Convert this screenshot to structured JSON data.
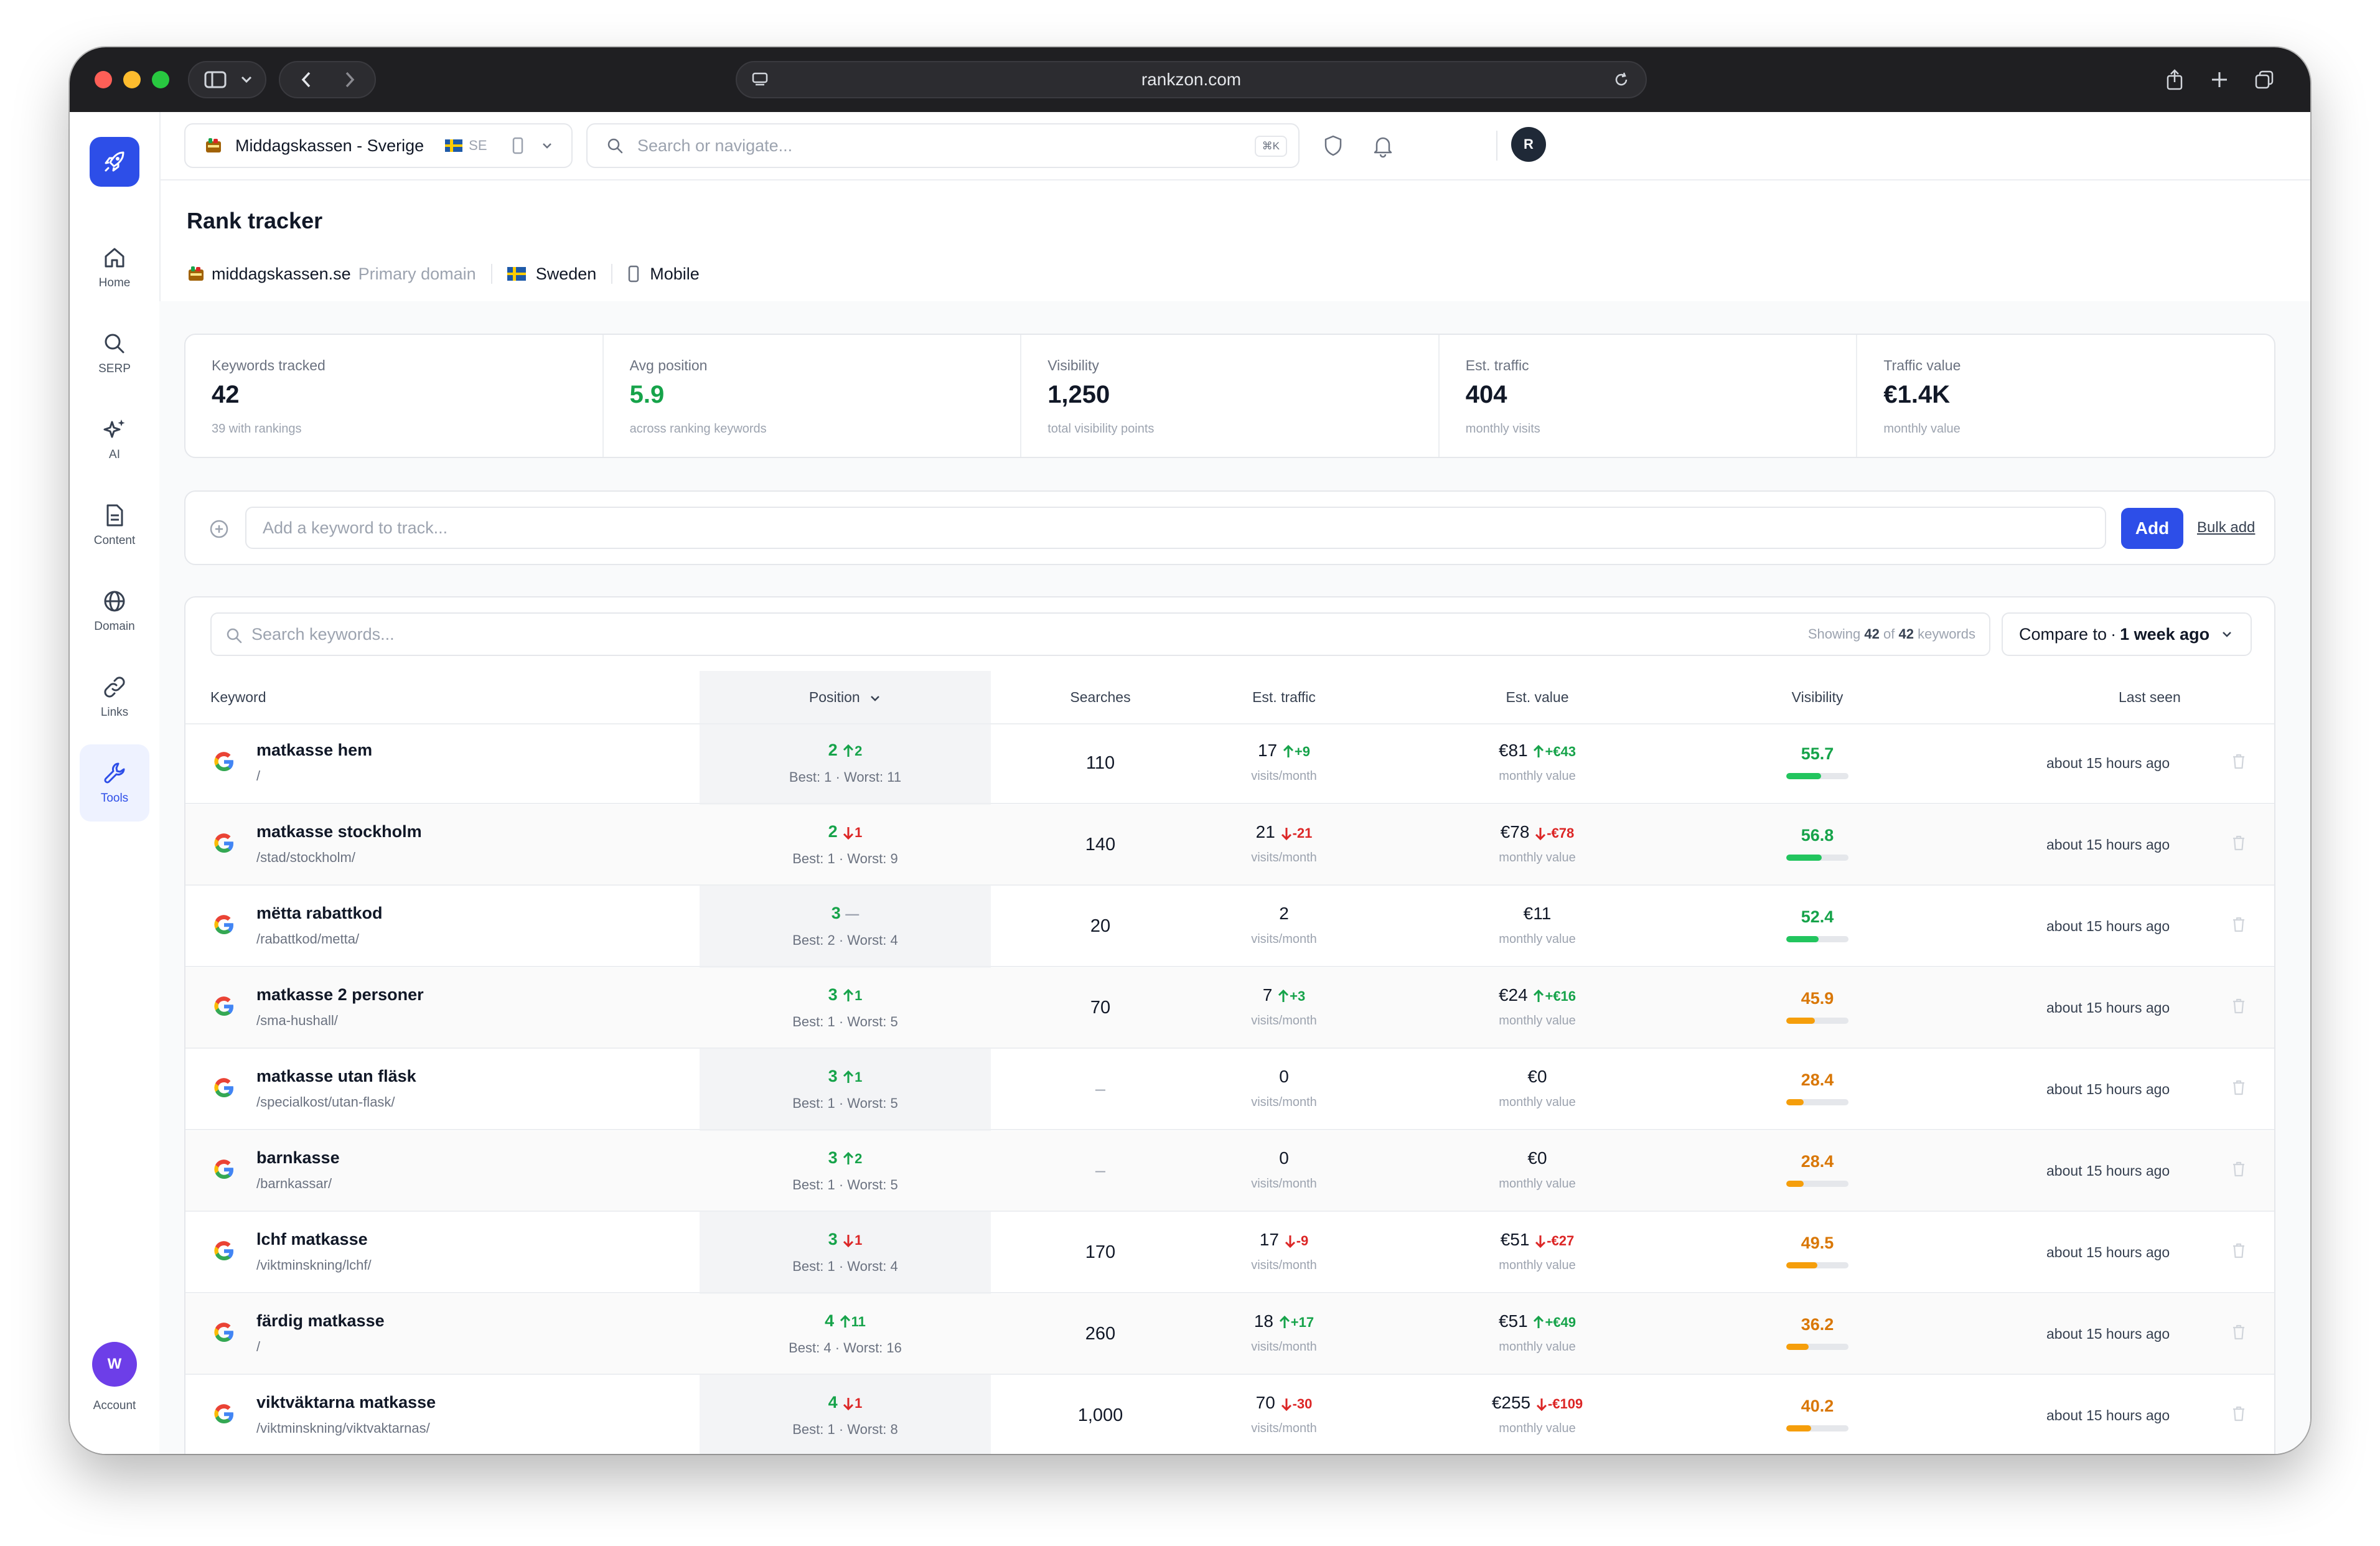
{
  "browser": {
    "url": "rankzon.com"
  },
  "sidebar": {
    "items": [
      {
        "label": "Home",
        "icon": "home-icon"
      },
      {
        "label": "SERP",
        "icon": "search-icon"
      },
      {
        "label": "AI",
        "icon": "sparkles-icon"
      },
      {
        "label": "Content",
        "icon": "document-icon"
      },
      {
        "label": "Domain",
        "icon": "globe-icon"
      },
      {
        "label": "Links",
        "icon": "link-icon"
      },
      {
        "label": "Tools",
        "icon": "wrench-icon",
        "active": true
      }
    ],
    "account": {
      "initial": "W",
      "label": "Account"
    }
  },
  "topbar": {
    "project": "Middagskassen - Sverige",
    "country_code": "SE",
    "search_placeholder": "Search or navigate...",
    "shortcut": "⌘K",
    "user_initial": "R"
  },
  "page": {
    "title": "Rank tracker",
    "domain": "middagskassen.se",
    "domain_tag": "Primary domain",
    "country": "Sweden",
    "device": "Mobile"
  },
  "stats": [
    {
      "label": "Keywords tracked",
      "value": "42",
      "sub": "39 with rankings"
    },
    {
      "label": "Avg position",
      "value": "5.9",
      "sub": "across ranking keywords",
      "accent": "#16a34a"
    },
    {
      "label": "Visibility",
      "value": "1,250",
      "sub": "total visibility points"
    },
    {
      "label": "Est. traffic",
      "value": "404",
      "sub": "monthly visits"
    },
    {
      "label": "Traffic value",
      "value": "€1.4K",
      "sub": "monthly value"
    }
  ],
  "add_keyword": {
    "placeholder": "Add a keyword to track...",
    "button": "Add",
    "bulk_link": "Bulk add"
  },
  "table_controls": {
    "search_placeholder": "Search keywords...",
    "showing_prefix": "Showing",
    "showing_count": "42",
    "showing_of": "of",
    "showing_total": "42",
    "showing_suffix": "keywords",
    "compare_label": "Compare to",
    "compare_value": "1 week ago"
  },
  "columns": {
    "keyword": "Keyword",
    "position": "Position",
    "searches": "Searches",
    "traffic": "Est. traffic",
    "value": "Est. value",
    "visibility": "Visibility",
    "last_seen": "Last seen"
  },
  "units": {
    "traffic": "visits/month",
    "value": "monthly value"
  },
  "colors": {
    "accent": "#2d4ee8",
    "up": "#16a34a",
    "down": "#dc2626",
    "vis_high": "#22c55e",
    "vis_mid": "#f59e0b"
  },
  "rows": [
    {
      "keyword": "matkasse hem",
      "url": "/",
      "position": "2",
      "pos_dir": "up",
      "pos_delta": "2",
      "best_worst": "Best: 1 · Worst: 11",
      "searches": "110",
      "traffic": "17",
      "traffic_dir": "up",
      "traffic_delta": "+9",
      "value": "€81",
      "value_dir": "up",
      "value_delta": "+€43",
      "visibility": "55.7",
      "vis_level": 0.557,
      "last_seen": "about 15 hours ago"
    },
    {
      "keyword": "matkasse stockholm",
      "url": "/stad/stockholm/",
      "position": "2",
      "pos_dir": "down",
      "pos_delta": "1",
      "best_worst": "Best: 1 · Worst: 9",
      "searches": "140",
      "traffic": "21",
      "traffic_dir": "down",
      "traffic_delta": "-21",
      "value": "€78",
      "value_dir": "down",
      "value_delta": "-€78",
      "visibility": "56.8",
      "vis_level": 0.568,
      "last_seen": "about 15 hours ago"
    },
    {
      "keyword": "mëtta rabattkod",
      "url": "/rabattkod/metta/",
      "position": "3",
      "pos_dir": "none",
      "pos_delta": "—",
      "best_worst": "Best: 2 · Worst: 4",
      "searches": "20",
      "traffic": "2",
      "traffic_dir": "none",
      "traffic_delta": "",
      "value": "€11",
      "value_dir": "none",
      "value_delta": "",
      "visibility": "52.4",
      "vis_level": 0.524,
      "last_seen": "about 15 hours ago"
    },
    {
      "keyword": "matkasse 2 personer",
      "url": "/sma-hushall/",
      "position": "3",
      "pos_dir": "up",
      "pos_delta": "1",
      "best_worst": "Best: 1 · Worst: 5",
      "searches": "70",
      "traffic": "7",
      "traffic_dir": "up",
      "traffic_delta": "+3",
      "value": "€24",
      "value_dir": "up",
      "value_delta": "+€16",
      "visibility": "45.9",
      "vis_level": 0.459,
      "last_seen": "about 15 hours ago"
    },
    {
      "keyword": "matkasse utan fläsk",
      "url": "/specialkost/utan-flask/",
      "position": "3",
      "pos_dir": "up",
      "pos_delta": "1",
      "best_worst": "Best: 1 · Worst: 5",
      "searches": "–",
      "traffic": "0",
      "traffic_dir": "none",
      "traffic_delta": "",
      "value": "€0",
      "value_dir": "none",
      "value_delta": "",
      "visibility": "28.4",
      "vis_level": 0.284,
      "last_seen": "about 15 hours ago"
    },
    {
      "keyword": "barnkasse",
      "url": "/barnkassar/",
      "position": "3",
      "pos_dir": "up",
      "pos_delta": "2",
      "best_worst": "Best: 1 · Worst: 5",
      "searches": "–",
      "traffic": "0",
      "traffic_dir": "none",
      "traffic_delta": "",
      "value": "€0",
      "value_dir": "none",
      "value_delta": "",
      "visibility": "28.4",
      "vis_level": 0.284,
      "last_seen": "about 15 hours ago"
    },
    {
      "keyword": "lchf matkasse",
      "url": "/viktminskning/lchf/",
      "position": "3",
      "pos_dir": "down",
      "pos_delta": "1",
      "best_worst": "Best: 1 · Worst: 4",
      "searches": "170",
      "traffic": "17",
      "traffic_dir": "down",
      "traffic_delta": "-9",
      "value": "€51",
      "value_dir": "down",
      "value_delta": "-€27",
      "visibility": "49.5",
      "vis_level": 0.495,
      "last_seen": "about 15 hours ago"
    },
    {
      "keyword": "färdig matkasse",
      "url": "/",
      "position": "4",
      "pos_dir": "up",
      "pos_delta": "11",
      "best_worst": "Best: 4 · Worst: 16",
      "searches": "260",
      "traffic": "18",
      "traffic_dir": "up",
      "traffic_delta": "+17",
      "value": "€51",
      "value_dir": "up",
      "value_delta": "+€49",
      "visibility": "36.2",
      "vis_level": 0.362,
      "last_seen": "about 15 hours ago"
    },
    {
      "keyword": "viktväktarna matkasse",
      "url": "/viktminskning/viktvaktarnas/",
      "position": "4",
      "pos_dir": "down",
      "pos_delta": "1",
      "best_worst": "Best: 1 · Worst: 8",
      "searches": "1,000",
      "traffic": "70",
      "traffic_dir": "down",
      "traffic_delta": "-30",
      "value": "€255",
      "value_dir": "down",
      "value_delta": "-€109",
      "visibility": "40.2",
      "vis_level": 0.402,
      "last_seen": "about 15 hours ago"
    }
  ]
}
